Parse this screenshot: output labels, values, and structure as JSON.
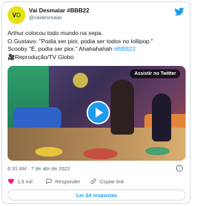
{
  "tweet": {
    "author": {
      "display_name": "Vai Desmaiar #BBB22",
      "handle": "@vaidesmaiar",
      "avatar_text_v": "V",
      "avatar_text_d": "D"
    },
    "text_lines": [
      "Arthur colocou todo mundo na xepa.",
      "O Gustavo: \"Podia ser pior, podia ser todos no lollipop.\"",
      "Scooby \"É, podia ser pior.\" Ahahahahah",
      "🎥Reprodução/TV Globo"
    ],
    "hashtag": "#BBB22",
    "media": {
      "watch_label": "Assistir no Twitter",
      "play_icon": "play-icon"
    },
    "timestamp": "6:31 AM · 7 de abr de 2022",
    "likes": "1,6 mil",
    "reply_label": "Responder",
    "copy_link_label": "Copiar link",
    "replies_button_label": "Ler 24 respostas",
    "colors": {
      "accent": "#1d9bf0",
      "like": "#f91880",
      "text": "#0f1419",
      "muted": "#536471"
    }
  }
}
